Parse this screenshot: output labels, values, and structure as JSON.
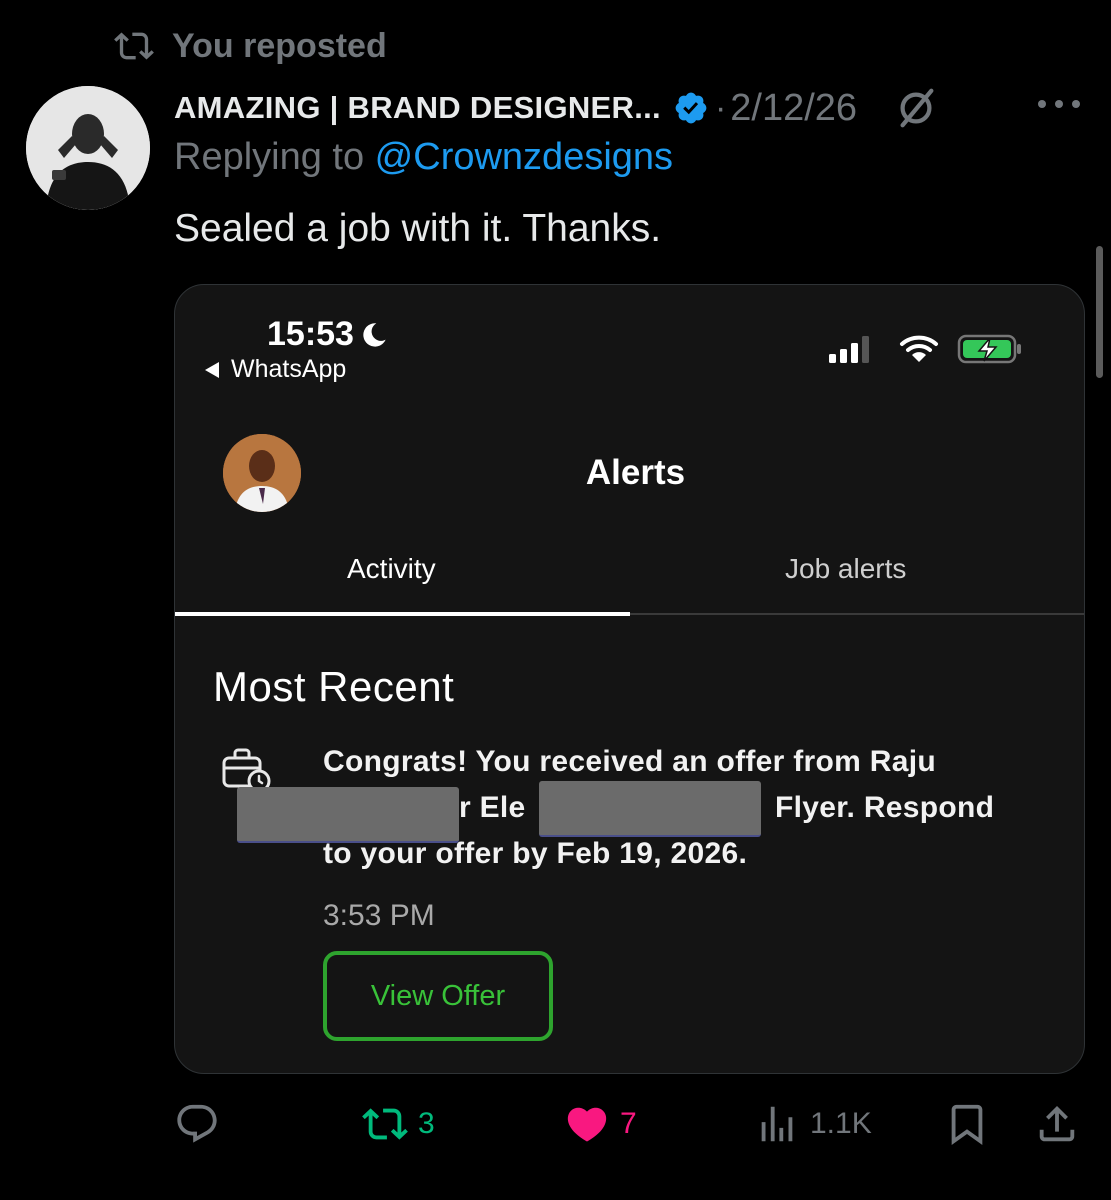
{
  "repost_banner": {
    "text": "You reposted"
  },
  "author": {
    "display_name": "AMAZING | BRAND DESIGNER...",
    "date": "2/12/26"
  },
  "reply_context": {
    "prefix": "Replying to ",
    "handle": "@Crownzdesigns"
  },
  "tweet": {
    "text": "Sealed a job with it. Thanks."
  },
  "embedded_screenshot": {
    "status_bar": {
      "time": "15:53",
      "back_app": "WhatsApp"
    },
    "page_title": "Alerts",
    "tabs": [
      {
        "label": "Activity",
        "active": true
      },
      {
        "label": "Job alerts",
        "active": false
      }
    ],
    "section_title": "Most Recent",
    "notification": {
      "line1": "Congrats! You received an offer from Raju",
      "line2": "r Ele",
      "line2b": "Flyer. Respond",
      "line3": "to your offer by Feb 19, 2026.",
      "time": "3:53 PM",
      "button_label": "View Offer"
    }
  },
  "actions": {
    "reposts": "3",
    "likes": "7",
    "views": "1.1K"
  },
  "colors": {
    "accent_blue": "#1d9bf0",
    "repost_green": "#00ba7c",
    "like_pink": "#f91880",
    "offer_green": "#2ea42e"
  },
  "icons": [
    "repost-icon",
    "verified-badge-icon",
    "grok-icon",
    "more-icon",
    "moon-icon",
    "signal-icon",
    "wifi-icon",
    "battery-charging-icon",
    "briefcase-clock-icon",
    "reply-icon",
    "like-icon",
    "views-icon",
    "bookmark-icon",
    "share-icon"
  ]
}
